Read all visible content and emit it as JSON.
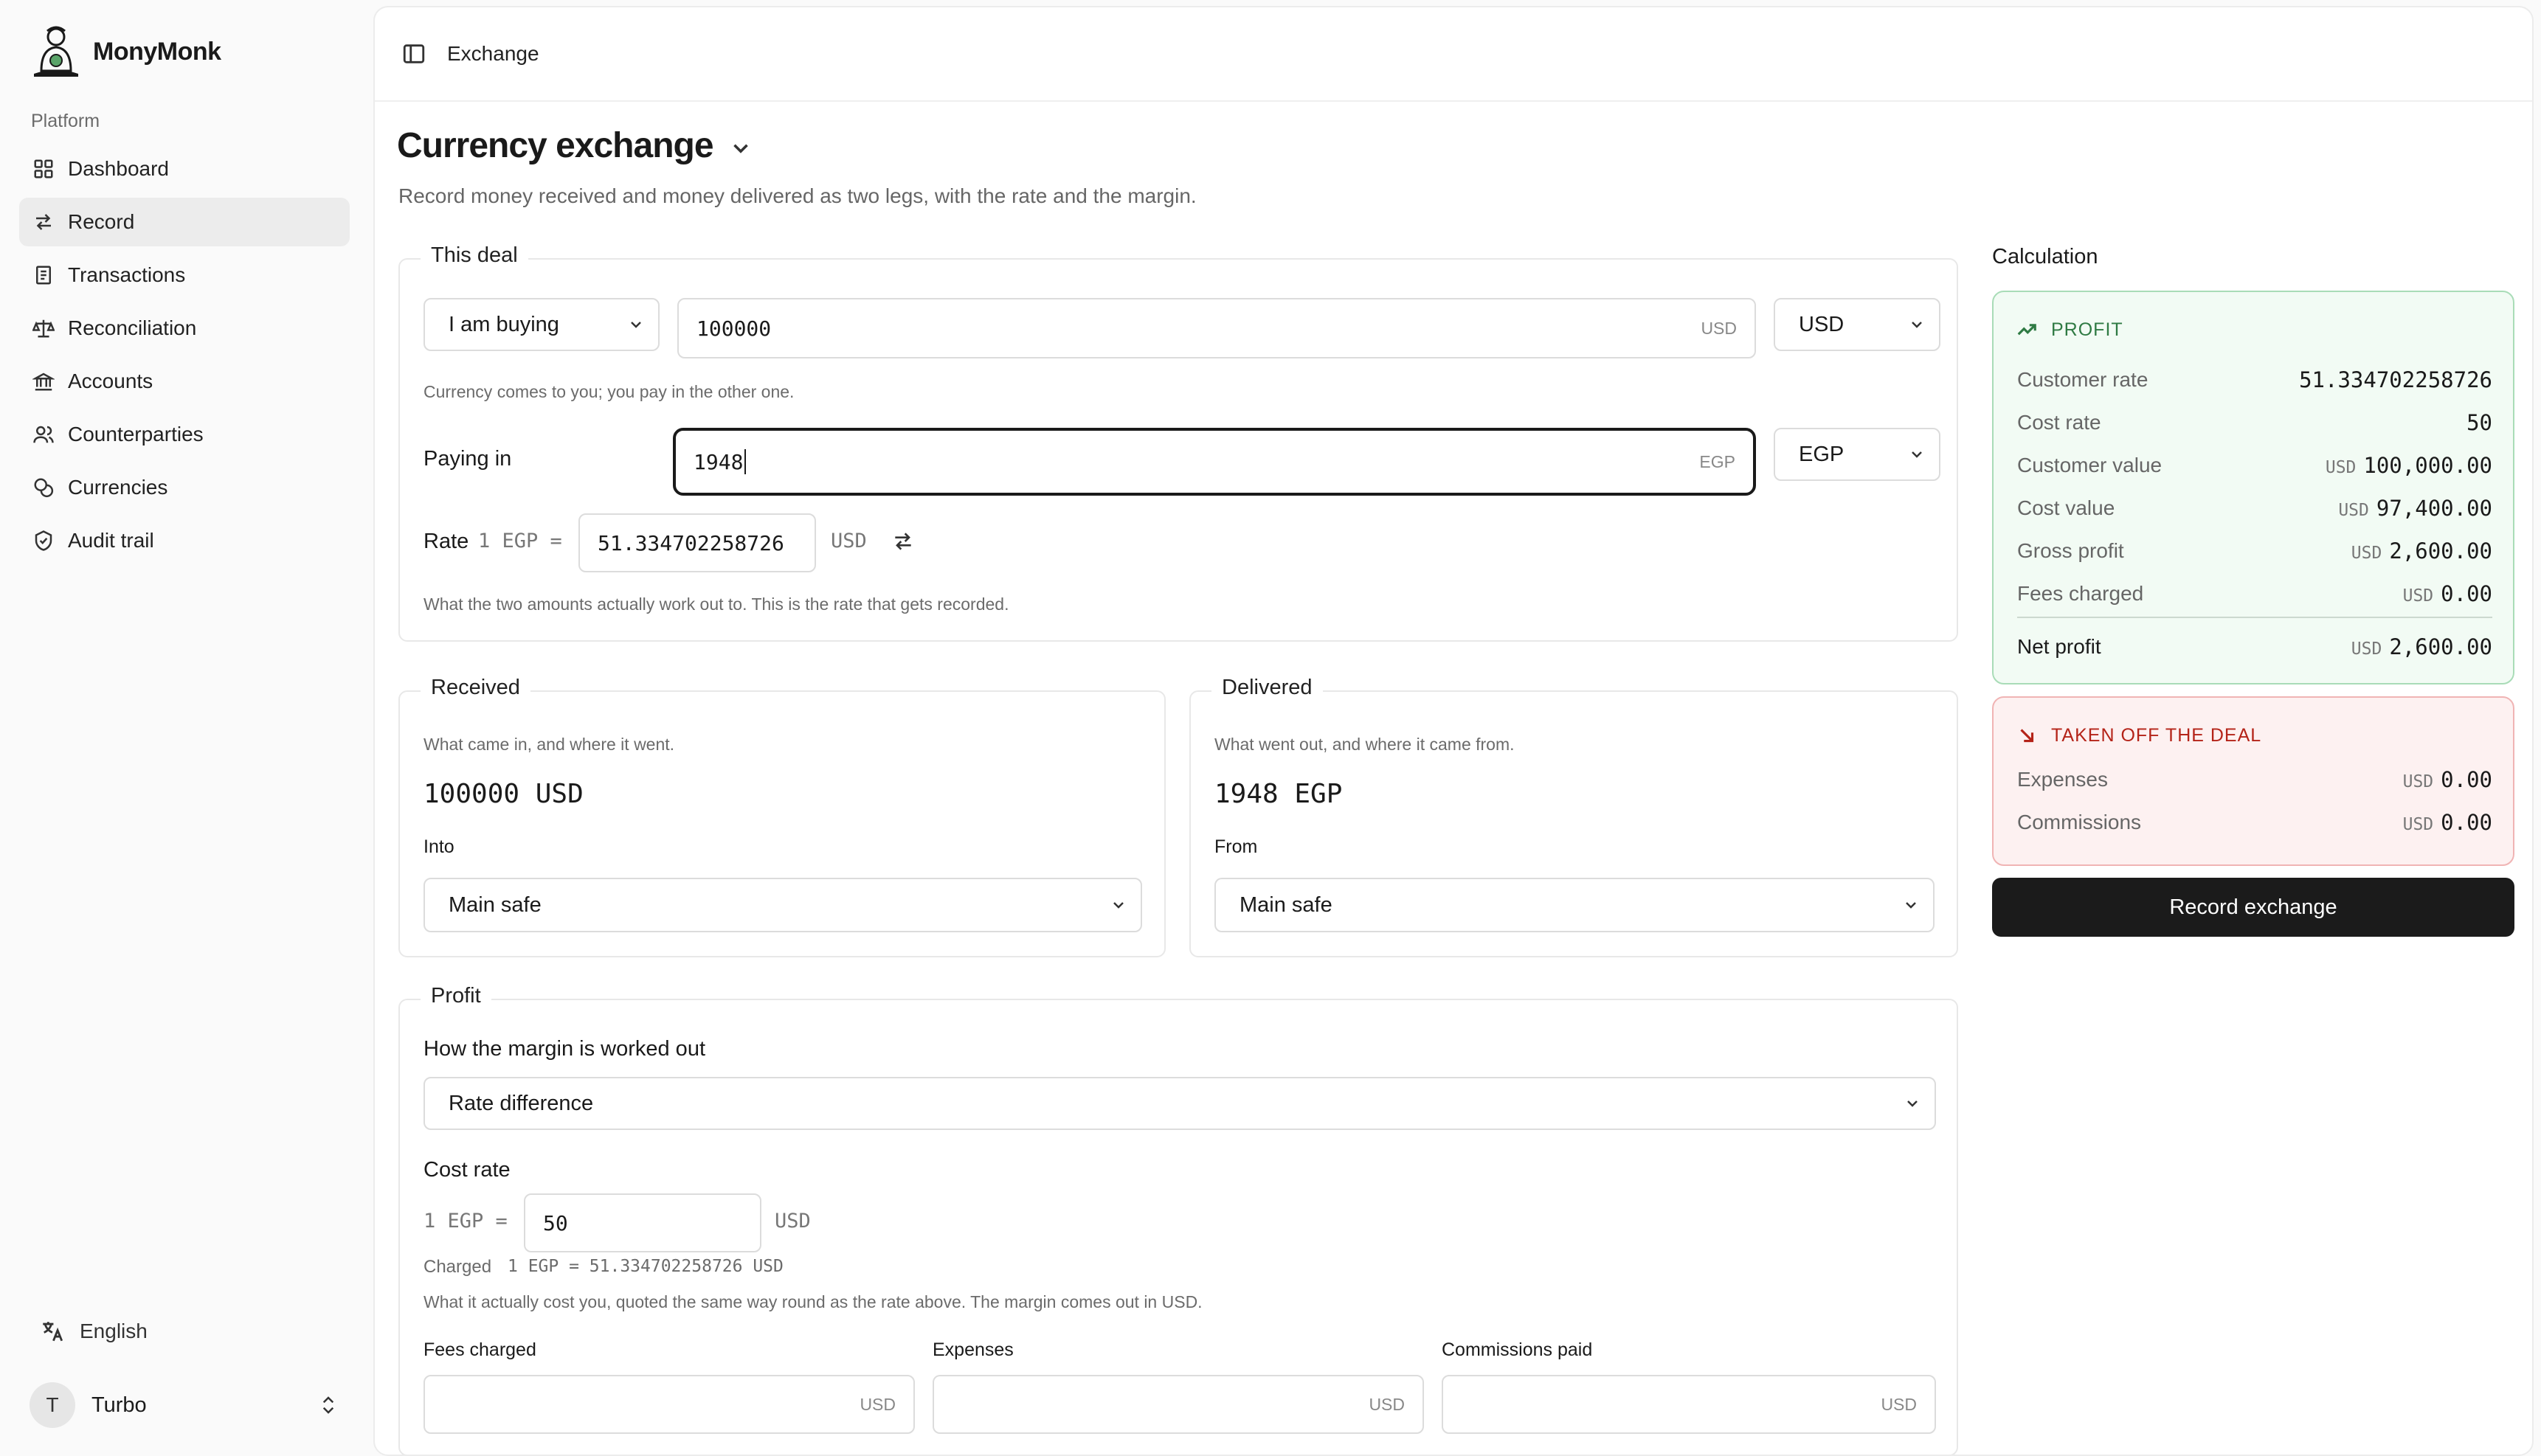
{
  "brand": {
    "name": "MonyMonk"
  },
  "sidebar": {
    "section": "Platform",
    "items": [
      {
        "label": "Dashboard",
        "icon": "grid-icon"
      },
      {
        "label": "Record",
        "icon": "swap-icon",
        "active": true
      },
      {
        "label": "Transactions",
        "icon": "receipt-icon"
      },
      {
        "label": "Reconciliation",
        "icon": "scale-icon"
      },
      {
        "label": "Accounts",
        "icon": "bank-icon"
      },
      {
        "label": "Counterparties",
        "icon": "users-icon"
      },
      {
        "label": "Currencies",
        "icon": "coins-icon"
      },
      {
        "label": "Audit trail",
        "icon": "shield-icon"
      }
    ],
    "language": "English",
    "user": {
      "initial": "T",
      "name": "Turbo"
    }
  },
  "topbar": {
    "crumb": "Exchange"
  },
  "page": {
    "title": "Currency exchange",
    "subtitle": "Record money received and money delivered as two legs, with the rate and the margin."
  },
  "deal": {
    "legend": "This deal",
    "direction": "I am buying",
    "amount": "100000",
    "amount_suffix": "USD",
    "currency": "USD",
    "hint": "Currency comes to you; you pay in the other one.",
    "paying_label": "Paying in",
    "paying_amount": "1948",
    "paying_suffix": "EGP",
    "paying_currency": "EGP",
    "rate_label": "Rate",
    "rate_prefix": "1 EGP =",
    "rate_value": "51.334702258726",
    "rate_suffix": "USD",
    "rate_hint": "What the two amounts actually work out to. This is the rate that gets recorded."
  },
  "received": {
    "legend": "Received",
    "hint": "What came in, and where it went.",
    "amount": "100000 USD",
    "into_label": "Into",
    "into_value": "Main safe"
  },
  "delivered": {
    "legend": "Delivered",
    "hint": "What went out, and where it came from.",
    "amount": "1948 EGP",
    "from_label": "From",
    "from_value": "Main safe"
  },
  "profit": {
    "legend": "Profit",
    "method_label": "How the margin is worked out",
    "method_value": "Rate difference",
    "cost_rate_label": "Cost rate",
    "cost_prefix": "1 EGP =",
    "cost_value": "50",
    "cost_suffix": "USD",
    "charged_label": "Charged",
    "charged_value": "1 EGP = 51.334702258726 USD",
    "cost_hint": "What it actually cost you, quoted the same way round as the rate above. The margin comes out in USD.",
    "fees_label": "Fees charged",
    "expenses_label": "Expenses",
    "commissions_label": "Commissions paid",
    "field_suffix": "USD"
  },
  "calculation": {
    "title": "Calculation",
    "profit_head": "PROFIT",
    "rows": [
      {
        "label": "Customer rate",
        "currency": "",
        "value": "51.334702258726"
      },
      {
        "label": "Cost rate",
        "currency": "",
        "value": "50"
      },
      {
        "label": "Customer value",
        "currency": "USD",
        "value": "100,000.00"
      },
      {
        "label": "Cost value",
        "currency": "USD",
        "value": "97,400.00"
      },
      {
        "label": "Gross profit",
        "currency": "USD",
        "value": "2,600.00"
      },
      {
        "label": "Fees charged",
        "currency": "USD",
        "value": "0.00"
      }
    ],
    "net": {
      "label": "Net profit",
      "currency": "USD",
      "value": "2,600.00"
    },
    "taken_head": "TAKEN OFF THE DEAL",
    "taken_rows": [
      {
        "label": "Expenses",
        "currency": "USD",
        "value": "0.00"
      },
      {
        "label": "Commissions",
        "currency": "USD",
        "value": "0.00"
      }
    ],
    "button": "Record exchange"
  },
  "colors": {
    "profit_accent": "#2f7a43",
    "loss_accent": "#b42318",
    "button_bg": "#1b1b1b"
  }
}
